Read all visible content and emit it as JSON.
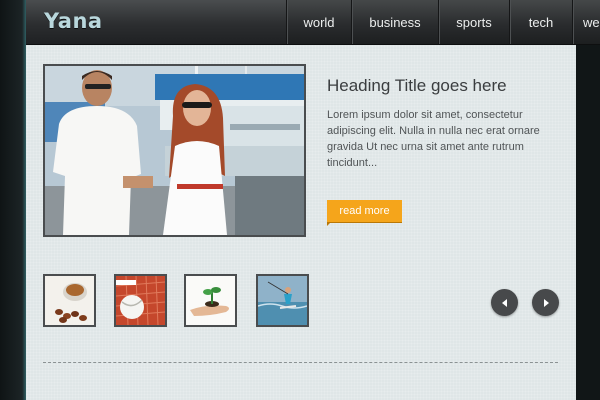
{
  "site": {
    "logo": "Yana"
  },
  "nav": {
    "items": [
      {
        "label": "world"
      },
      {
        "label": "business"
      },
      {
        "label": "sports"
      },
      {
        "label": "tech"
      },
      {
        "label": "we"
      }
    ]
  },
  "feature": {
    "image_icon": "couple-photo",
    "heading": "Heading Title goes here",
    "excerpt": "Lorem ipsum dolor sit amet, consectetur adipiscing elit. Nulla in nulla nec erat ornare gravida Ut nec urna sit amet ante rutrum tincidunt...",
    "read_more_label": "read more"
  },
  "thumbnails": [
    {
      "icon": "coffee-beans-thumbnail"
    },
    {
      "icon": "tennis-ball-thumbnail"
    },
    {
      "icon": "plant-in-hand-thumbnail"
    },
    {
      "icon": "kitesurfing-thumbnail"
    }
  ],
  "slider": {
    "prev_icon": "chevron-left-icon",
    "next_icon": "chevron-right-icon"
  },
  "colors": {
    "accent": "#f5a51b",
    "header": "#2c2e30",
    "panel": "#dfe6e7",
    "logo": "#b9d7dc"
  }
}
